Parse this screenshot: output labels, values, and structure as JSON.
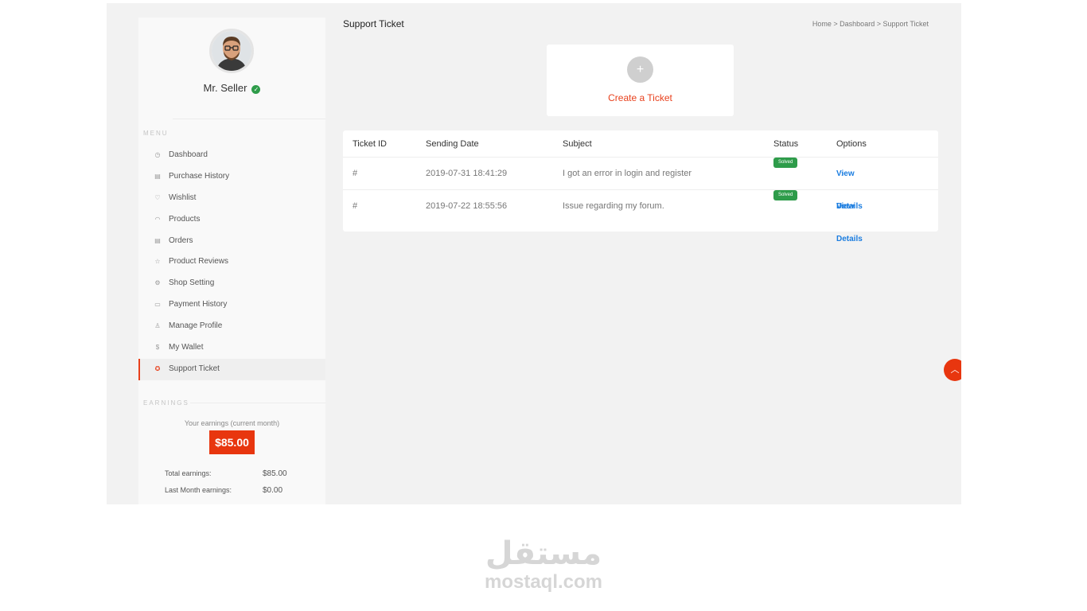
{
  "user": {
    "name": "Mr. Seller"
  },
  "sidebar": {
    "menu_heading": "MENU",
    "items": [
      {
        "label": "Dashboard",
        "icon": "dashboard-icon"
      },
      {
        "label": "Purchase History",
        "icon": "file-icon"
      },
      {
        "label": "Wishlist",
        "icon": "heart-icon"
      },
      {
        "label": "Products",
        "icon": "wifi-icon"
      },
      {
        "label": "Orders",
        "icon": "file-icon"
      },
      {
        "label": "Product Reviews",
        "icon": "star-icon"
      },
      {
        "label": "Shop Setting",
        "icon": "gear-icon"
      },
      {
        "label": "Payment History",
        "icon": "card-icon"
      },
      {
        "label": "Manage Profile",
        "icon": "user-icon"
      },
      {
        "label": "My Wallet",
        "icon": "dollar-icon"
      },
      {
        "label": "Support Ticket",
        "icon": "lifebuoy-icon"
      }
    ],
    "active_item": "Support Ticket",
    "earnings_heading": "EARNINGS",
    "earnings_caption": "Your earnings (current month)",
    "current_month_amount": "$85.00",
    "total_label": "Total earnings:",
    "total_value": "$85.00",
    "last_month_label": "Last Month earnings:",
    "last_month_value": "$0.00"
  },
  "page": {
    "title": "Support Ticket",
    "breadcrumb": "Home > Dashboard > Support Ticket",
    "create_label": "Create a Ticket",
    "create_symbol": "+"
  },
  "tickets": {
    "headers": [
      "Ticket ID",
      "Sending Date",
      "Subject",
      "Status",
      "Options"
    ],
    "rows": [
      {
        "id": "#",
        "date": "2019-07-31 18:41:29",
        "subject": "I got an error in login and register",
        "status": "Solved",
        "option": "View Details"
      },
      {
        "id": "#",
        "date": "2019-07-22 18:55:56",
        "subject": "Issue regarding my forum.",
        "status": "Solved",
        "option": "View Details"
      }
    ]
  },
  "watermark": {
    "arabic": "مستقل",
    "latin": "mostaql.com"
  },
  "colors": {
    "accent": "#e8360f",
    "success": "#2e9c4a",
    "link": "#1b7de0"
  }
}
